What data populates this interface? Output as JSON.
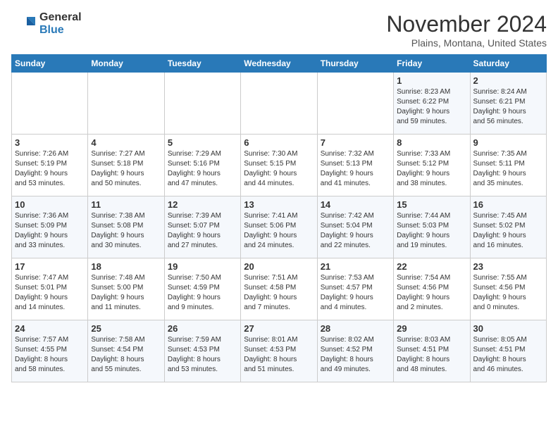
{
  "header": {
    "logo_general": "General",
    "logo_blue": "Blue",
    "month_title": "November 2024",
    "location": "Plains, Montana, United States"
  },
  "weekdays": [
    "Sunday",
    "Monday",
    "Tuesday",
    "Wednesday",
    "Thursday",
    "Friday",
    "Saturday"
  ],
  "weeks": [
    [
      {
        "day": "",
        "info": ""
      },
      {
        "day": "",
        "info": ""
      },
      {
        "day": "",
        "info": ""
      },
      {
        "day": "",
        "info": ""
      },
      {
        "day": "",
        "info": ""
      },
      {
        "day": "1",
        "info": "Sunrise: 8:23 AM\nSunset: 6:22 PM\nDaylight: 9 hours\nand 59 minutes."
      },
      {
        "day": "2",
        "info": "Sunrise: 8:24 AM\nSunset: 6:21 PM\nDaylight: 9 hours\nand 56 minutes."
      }
    ],
    [
      {
        "day": "3",
        "info": "Sunrise: 7:26 AM\nSunset: 5:19 PM\nDaylight: 9 hours\nand 53 minutes."
      },
      {
        "day": "4",
        "info": "Sunrise: 7:27 AM\nSunset: 5:18 PM\nDaylight: 9 hours\nand 50 minutes."
      },
      {
        "day": "5",
        "info": "Sunrise: 7:29 AM\nSunset: 5:16 PM\nDaylight: 9 hours\nand 47 minutes."
      },
      {
        "day": "6",
        "info": "Sunrise: 7:30 AM\nSunset: 5:15 PM\nDaylight: 9 hours\nand 44 minutes."
      },
      {
        "day": "7",
        "info": "Sunrise: 7:32 AM\nSunset: 5:13 PM\nDaylight: 9 hours\nand 41 minutes."
      },
      {
        "day": "8",
        "info": "Sunrise: 7:33 AM\nSunset: 5:12 PM\nDaylight: 9 hours\nand 38 minutes."
      },
      {
        "day": "9",
        "info": "Sunrise: 7:35 AM\nSunset: 5:11 PM\nDaylight: 9 hours\nand 35 minutes."
      }
    ],
    [
      {
        "day": "10",
        "info": "Sunrise: 7:36 AM\nSunset: 5:09 PM\nDaylight: 9 hours\nand 33 minutes."
      },
      {
        "day": "11",
        "info": "Sunrise: 7:38 AM\nSunset: 5:08 PM\nDaylight: 9 hours\nand 30 minutes."
      },
      {
        "day": "12",
        "info": "Sunrise: 7:39 AM\nSunset: 5:07 PM\nDaylight: 9 hours\nand 27 minutes."
      },
      {
        "day": "13",
        "info": "Sunrise: 7:41 AM\nSunset: 5:06 PM\nDaylight: 9 hours\nand 24 minutes."
      },
      {
        "day": "14",
        "info": "Sunrise: 7:42 AM\nSunset: 5:04 PM\nDaylight: 9 hours\nand 22 minutes."
      },
      {
        "day": "15",
        "info": "Sunrise: 7:44 AM\nSunset: 5:03 PM\nDaylight: 9 hours\nand 19 minutes."
      },
      {
        "day": "16",
        "info": "Sunrise: 7:45 AM\nSunset: 5:02 PM\nDaylight: 9 hours\nand 16 minutes."
      }
    ],
    [
      {
        "day": "17",
        "info": "Sunrise: 7:47 AM\nSunset: 5:01 PM\nDaylight: 9 hours\nand 14 minutes."
      },
      {
        "day": "18",
        "info": "Sunrise: 7:48 AM\nSunset: 5:00 PM\nDaylight: 9 hours\nand 11 minutes."
      },
      {
        "day": "19",
        "info": "Sunrise: 7:50 AM\nSunset: 4:59 PM\nDaylight: 9 hours\nand 9 minutes."
      },
      {
        "day": "20",
        "info": "Sunrise: 7:51 AM\nSunset: 4:58 PM\nDaylight: 9 hours\nand 7 minutes."
      },
      {
        "day": "21",
        "info": "Sunrise: 7:53 AM\nSunset: 4:57 PM\nDaylight: 9 hours\nand 4 minutes."
      },
      {
        "day": "22",
        "info": "Sunrise: 7:54 AM\nSunset: 4:56 PM\nDaylight: 9 hours\nand 2 minutes."
      },
      {
        "day": "23",
        "info": "Sunrise: 7:55 AM\nSunset: 4:56 PM\nDaylight: 9 hours\nand 0 minutes."
      }
    ],
    [
      {
        "day": "24",
        "info": "Sunrise: 7:57 AM\nSunset: 4:55 PM\nDaylight: 8 hours\nand 58 minutes."
      },
      {
        "day": "25",
        "info": "Sunrise: 7:58 AM\nSunset: 4:54 PM\nDaylight: 8 hours\nand 55 minutes."
      },
      {
        "day": "26",
        "info": "Sunrise: 7:59 AM\nSunset: 4:53 PM\nDaylight: 8 hours\nand 53 minutes."
      },
      {
        "day": "27",
        "info": "Sunrise: 8:01 AM\nSunset: 4:53 PM\nDaylight: 8 hours\nand 51 minutes."
      },
      {
        "day": "28",
        "info": "Sunrise: 8:02 AM\nSunset: 4:52 PM\nDaylight: 8 hours\nand 49 minutes."
      },
      {
        "day": "29",
        "info": "Sunrise: 8:03 AM\nSunset: 4:51 PM\nDaylight: 8 hours\nand 48 minutes."
      },
      {
        "day": "30",
        "info": "Sunrise: 8:05 AM\nSunset: 4:51 PM\nDaylight: 8 hours\nand 46 minutes."
      }
    ]
  ]
}
